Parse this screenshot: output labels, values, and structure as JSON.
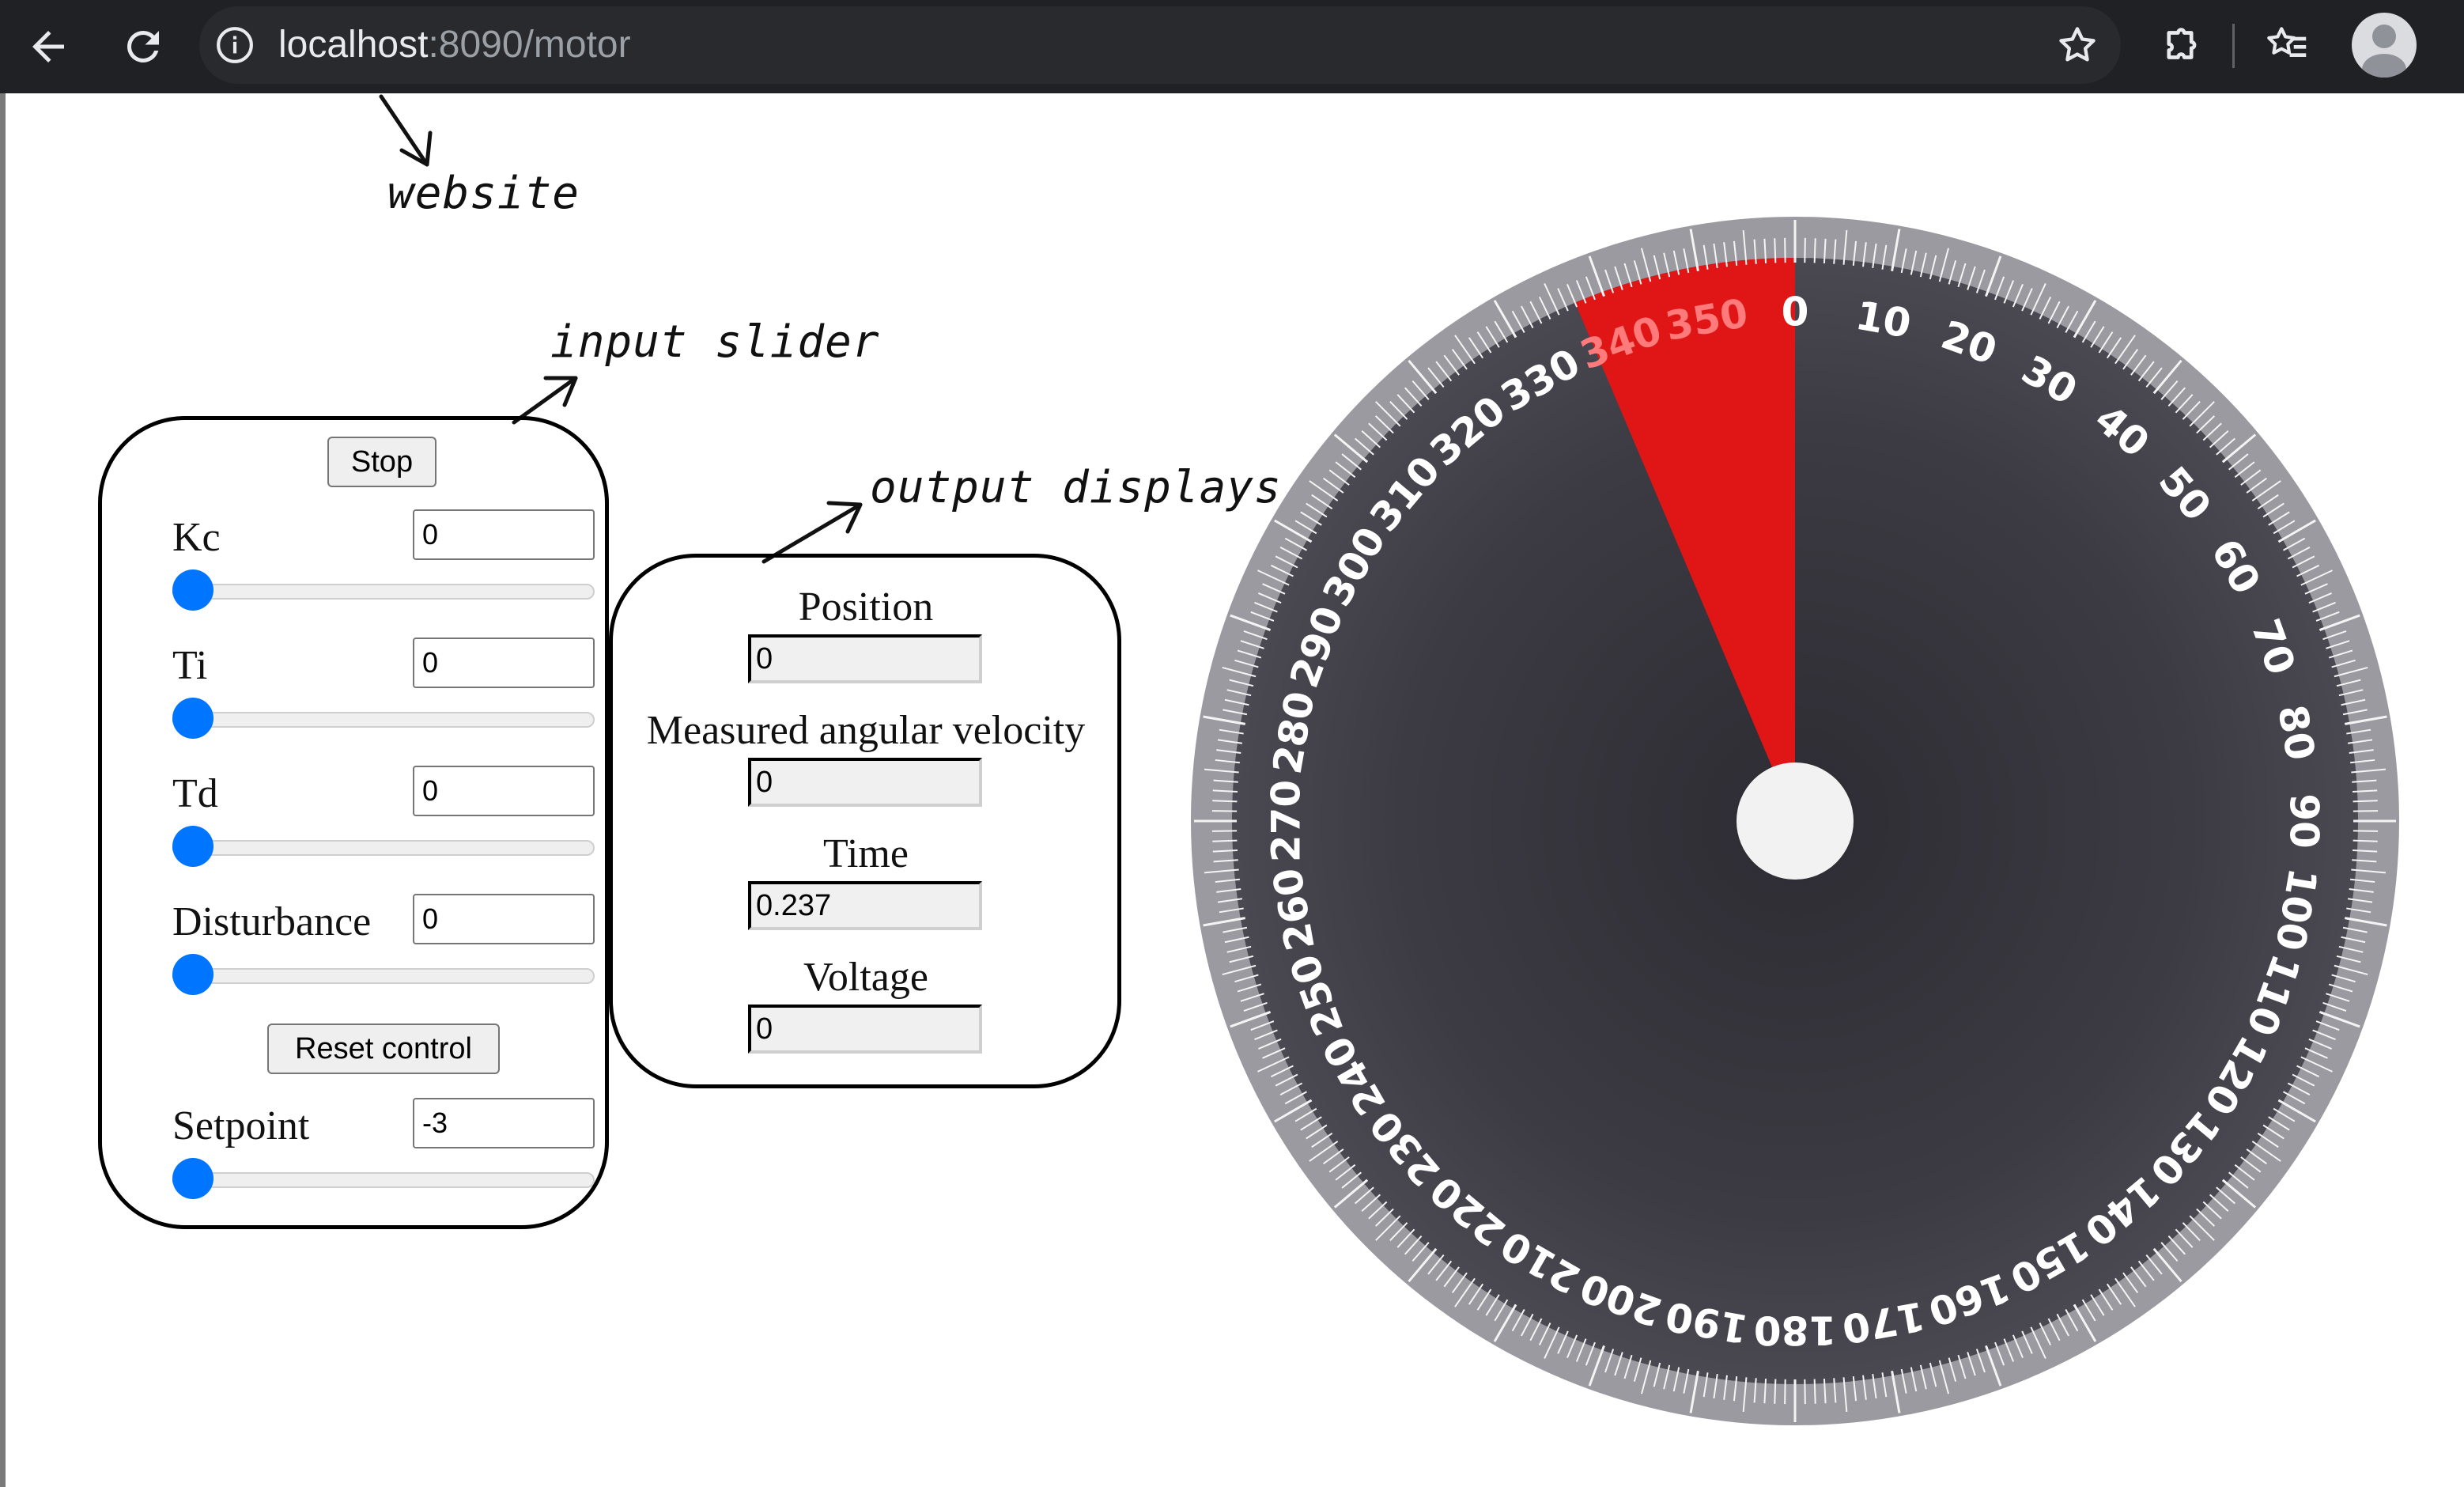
{
  "browser": {
    "url_host": "localhost",
    "url_rest": ":8090/motor",
    "icons": [
      "back-arrow-icon",
      "reload-icon",
      "info-icon",
      "star-icon",
      "extensions-icon",
      "reading-list-icon",
      "profile-avatar-icon"
    ]
  },
  "annotations": {
    "website": "website",
    "input_slider": "input slider",
    "output_displays": "output displays"
  },
  "controls": {
    "stop_label": "Stop",
    "reset_label": "Reset control",
    "params": [
      {
        "label": "Kc",
        "value": "0",
        "slider_fraction": 0
      },
      {
        "label": "Ti",
        "value": "0",
        "slider_fraction": 0
      },
      {
        "label": "Td",
        "value": "0",
        "slider_fraction": 0
      },
      {
        "label": "Disturbance",
        "value": "0",
        "slider_fraction": 0
      }
    ],
    "setpoint": {
      "label": "Setpoint",
      "value": "-3",
      "slider_fraction": 0
    }
  },
  "outputs": [
    {
      "label": "Position",
      "value": "0"
    },
    {
      "label": "Measured angular velocity",
      "value": "0"
    },
    {
      "label": "Time",
      "value": "0.237"
    },
    {
      "label": "Voltage",
      "value": "0"
    }
  ],
  "dial": {
    "outer_labels_cw": [
      "0",
      "10",
      "20",
      "30",
      "40",
      "50",
      "60",
      "70",
      "80",
      "90",
      "100",
      "110",
      "120",
      "130",
      "140",
      "150",
      "160",
      "170",
      "180"
    ],
    "outer_labels_ccw": [
      "330",
      "320",
      "310",
      "300",
      "290",
      "280",
      "270",
      "260",
      "250",
      "240",
      "230",
      "220",
      "210",
      "200",
      "190"
    ],
    "highlight_labels": [
      "340",
      "350"
    ],
    "highlight_from_deg": 337,
    "highlight_to_deg": 360,
    "colors": {
      "face": "#3a3840",
      "highlight": "#e01616",
      "hub": "#f2f2f2",
      "rim": "#8e8e94",
      "label": "#ffffff"
    }
  }
}
